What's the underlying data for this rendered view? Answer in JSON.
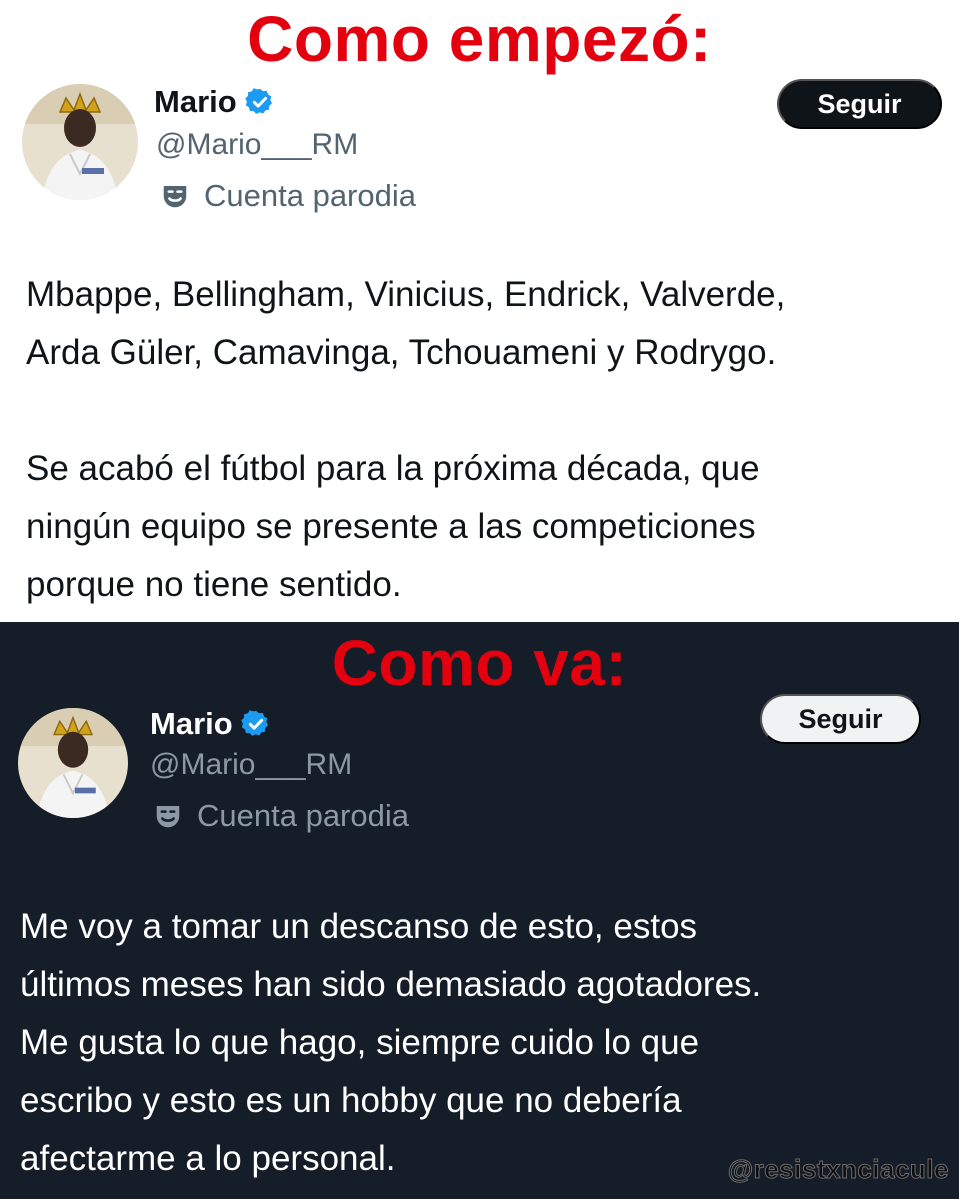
{
  "top": {
    "caption": "Como empezó:",
    "name": "Mario",
    "handle": "@Mario___RM",
    "parody_label": "Cuenta parodia",
    "follow_label": "Seguir",
    "text": "Mbappe, Bellingham, Vinicius, Endrick, Valverde,\nArda Güler, Camavinga, Tchouameni y Rodrygo.\n\nSe acabó el fútbol para la próxima década, que\nningún equipo se presente a las competiciones\nporque no tiene sentido."
  },
  "bottom": {
    "caption": "Como va:",
    "name": "Mario",
    "handle": "@Mario___RM",
    "parody_label": "Cuenta parodia",
    "follow_label": "Seguir",
    "text": "Me voy a tomar un descanso de esto, estos\núltimos meses han sido demasiado agotadores.\nMe gusta lo que hago, siempre cuido lo que\nescribo  y esto es un hobby que no debería\nafectarme a lo personal."
  },
  "watermark": "@resistxnciacule",
  "icons": {
    "verified": "verified-badge-icon",
    "parody": "theater-mask-icon"
  },
  "colors": {
    "caption": "#e3000f",
    "verified": "#1d9bf0",
    "dark_bg": "#151d28"
  }
}
